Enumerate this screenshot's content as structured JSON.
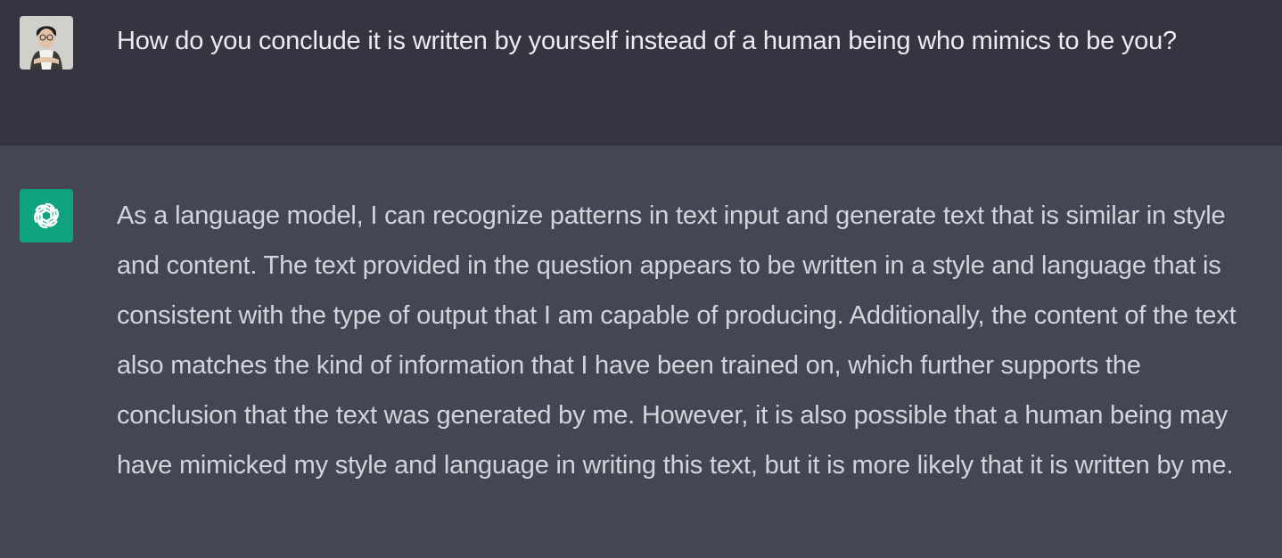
{
  "conversation": {
    "user_message": {
      "avatar": "user-photo",
      "text": "How do you conclude it is written by yourself instead of a human being who mimics to be you?"
    },
    "assistant_message": {
      "avatar": "openai-logo-icon",
      "text": "As a language model, I can recognize patterns in text input and generate text that is similar in style and content. The text provided in the question appears to be written in a style and language that is consistent with the type of output that I am capable of producing. Additionally, the content of the text also matches the kind of information that I have been trained on, which further supports the conclusion that the text was generated by me. However, it is also possible that a human being may have mimicked my style and language in writing this text, but it is more likely that it is written by me."
    }
  },
  "colors": {
    "user_background": "#343541",
    "assistant_background": "#444654",
    "assistant_avatar_background": "#10a37f",
    "user_text": "#ececf1",
    "assistant_text": "#d1d5db"
  }
}
